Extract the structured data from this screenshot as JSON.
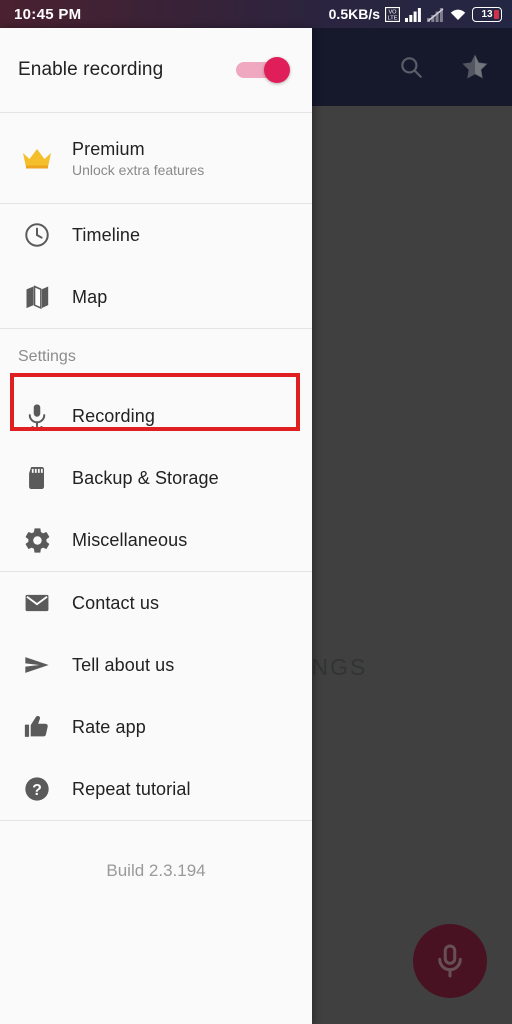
{
  "status_bar": {
    "time": "10:45 PM",
    "network_speed": "0.5KB/s",
    "icons": [
      "volte-hd-icon",
      "signal-bars-icon",
      "signal-bars-off-icon",
      "wifi-icon"
    ],
    "battery_level": "13"
  },
  "app_bar": {
    "icons": [
      "search-icon",
      "star-half-icon"
    ]
  },
  "background": {
    "empty_text": "NO RECORDINGS",
    "fab_icon": "microphone-icon"
  },
  "drawer": {
    "enable_recording": {
      "label": "Enable recording",
      "toggle_state": "on",
      "toggle_on_color": "#e01e5a",
      "toggle_track_color": "#f0a8c0"
    },
    "premium": {
      "icon": "crown-icon",
      "title": "Premium",
      "subtitle": "Unlock extra features",
      "icon_color": "#f5b820"
    },
    "nav_items": [
      {
        "icon": "clock-icon",
        "label": "Timeline"
      },
      {
        "icon": "map-icon",
        "label": "Map"
      }
    ],
    "settings_section": {
      "header": "Settings",
      "items": [
        {
          "icon": "microphone-icon",
          "label": "Recording",
          "highlighted": true
        },
        {
          "icon": "sd-card-icon",
          "label": "Backup & Storage",
          "highlighted": false
        },
        {
          "icon": "gear-icon",
          "label": "Miscellaneous",
          "highlighted": false
        }
      ]
    },
    "support_items": [
      {
        "icon": "envelope-icon",
        "label": "Contact us"
      },
      {
        "icon": "send-icon",
        "label": "Tell about us"
      },
      {
        "icon": "thumbs-up-icon",
        "label": "Rate app"
      },
      {
        "icon": "question-circle-icon",
        "label": "Repeat tutorial"
      }
    ],
    "build": "Build 2.3.194",
    "highlight_color": "#e02020"
  }
}
